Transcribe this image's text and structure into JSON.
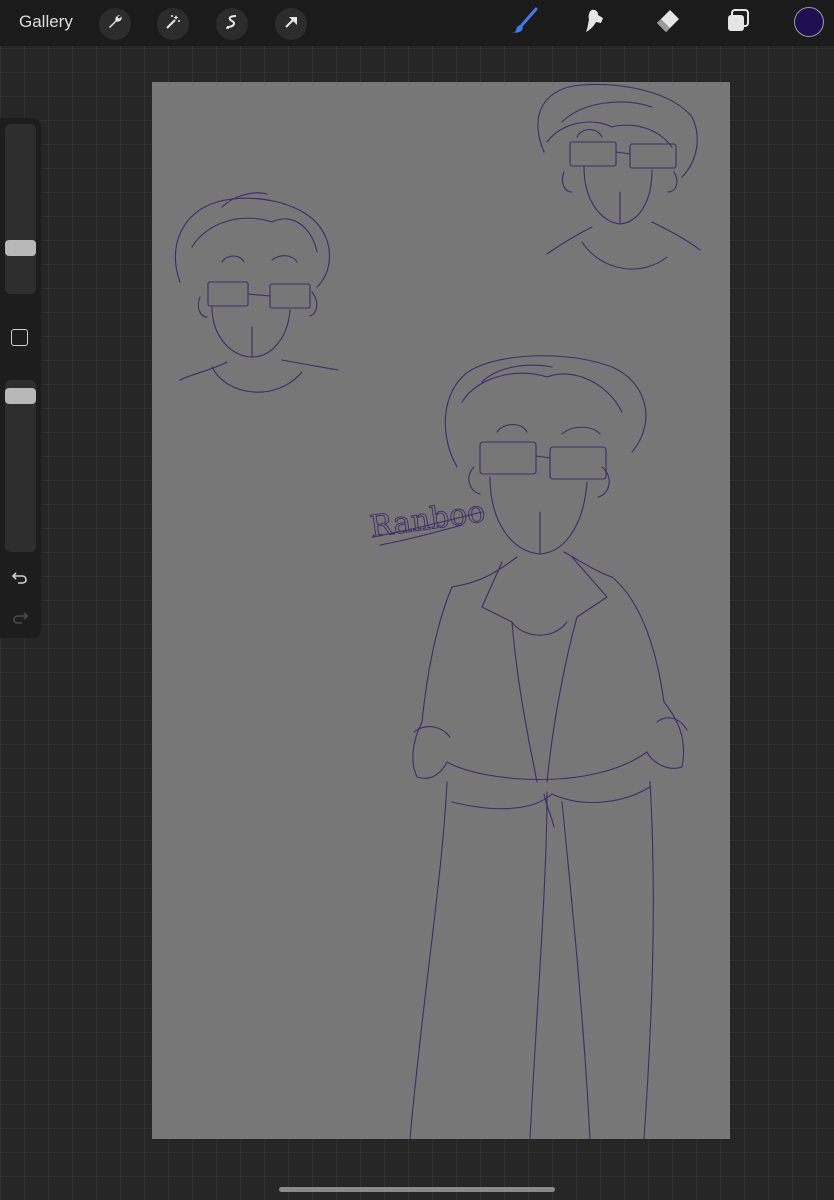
{
  "app": {
    "gallery_label": "Gallery"
  },
  "toolbar": {
    "left_icons": [
      "wrench-icon",
      "magic-wand-icon",
      "selection-icon",
      "transform-arrow-icon"
    ],
    "right_icons": [
      "brush-icon",
      "smudge-icon",
      "eraser-icon",
      "layers-icon"
    ],
    "active_tool": "brush",
    "active_color": "#1f0f52",
    "accent_color": "#3d7bf5"
  },
  "sidebar": {
    "icons": [
      "modify-square-icon",
      "undo-icon",
      "redo-icon"
    ],
    "brush_size_level": 0.25,
    "opacity_level": 0.95
  },
  "canvas": {
    "background": "#777777",
    "stroke_color": "#3b2d6b",
    "signature_text": "Ranboo"
  }
}
